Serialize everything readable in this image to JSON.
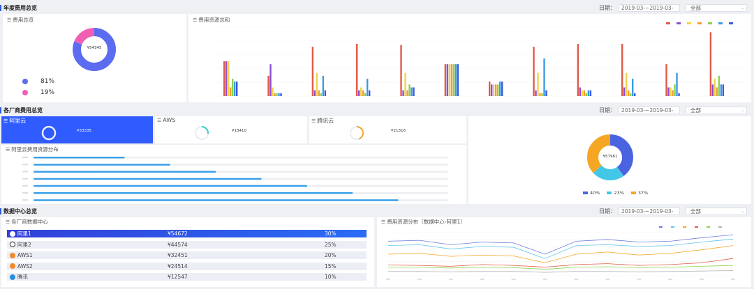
{
  "sections": {
    "annual": {
      "title": "年度费用总览",
      "date_label": "日期：",
      "date_value": "2019-03-~2019-03-",
      "select_value": "全部"
    },
    "vendor": {
      "title": "各厂商费用总览",
      "date_label": "日期：",
      "date_value": "2019-03-~2019-03-",
      "select_value": "全部"
    },
    "datacenter": {
      "title": "数据中心总览",
      "date_label": "日期：",
      "date_value": "2019-03-~2019-03-",
      "select_value": "全部"
    }
  },
  "cost_total": {
    "title": "费用总览",
    "center_value": "¥54345",
    "legend": [
      {
        "percent": "81%",
        "color": "#5b6cf0"
      },
      {
        "percent": "19%",
        "color": "#f05fb4"
      }
    ]
  },
  "resource_total": {
    "title": "费用资源总和"
  },
  "vendor_cards": [
    {
      "name": "阿里云",
      "value": "¥33335",
      "active": true
    },
    {
      "name": "AWS",
      "value": "¥13410",
      "active": false
    },
    {
      "name": "腾讯云",
      "value": "¥21316",
      "active": false
    }
  ],
  "aliyun_dist": {
    "title": "阿里云费用资源分布"
  },
  "vendor_donut": {
    "center_value": "¥57961",
    "legend": [
      {
        "percent": "40%",
        "color": "#4a63e0"
      },
      {
        "percent": "23%",
        "color": "#42c8e6"
      },
      {
        "percent": "37%",
        "color": "#f5a623"
      }
    ]
  },
  "dc_table": {
    "title": "各厂商数据中心",
    "rows": [
      {
        "name": "阿里1",
        "value": "¥54672",
        "percent": "30%",
        "icon": "aliyun-icon",
        "color": "#fff",
        "active": true
      },
      {
        "name": "阿里2",
        "value": "¥44574",
        "percent": "25%",
        "icon": "aliyun-icon",
        "color": "#333",
        "active": false
      },
      {
        "name": "AWS1",
        "value": "¥32451",
        "percent": "20%",
        "icon": "aws-icon",
        "color": "#f08a2a",
        "active": false
      },
      {
        "name": "AWS2",
        "value": "¥24514",
        "percent": "15%",
        "icon": "aws-icon",
        "color": "#f08a2a",
        "active": false
      },
      {
        "name": "腾讯",
        "value": "¥12547",
        "percent": "10%",
        "icon": "tencent-icon",
        "color": "#2a8de0",
        "active": false
      }
    ]
  },
  "dc_trend": {
    "title": "费用资源分布（数据中心-阿里1）"
  },
  "chart_data": [
    {
      "type": "bar",
      "title": "费用资源总和",
      "categories": [
        "1",
        "2",
        "3",
        "4",
        "5",
        "6",
        "7",
        "8",
        "9",
        "10",
        "11",
        "12"
      ],
      "series": [
        {
          "color": "#e05a47",
          "values": [
            60,
            35,
            85,
            90,
            88,
            55,
            25,
            85,
            90,
            90,
            55,
            110
          ]
        },
        {
          "color": "#8a4fd8",
          "values": [
            60,
            55,
            10,
            10,
            10,
            55,
            20,
            10,
            15,
            15,
            15,
            20
          ]
        },
        {
          "color": "#f2d34b",
          "values": [
            60,
            15,
            40,
            15,
            40,
            55,
            20,
            40,
            10,
            40,
            15,
            30
          ]
        },
        {
          "color": "#f59c37",
          "values": [
            15,
            5,
            10,
            10,
            10,
            55,
            20,
            5,
            10,
            10,
            10,
            15
          ]
        },
        {
          "color": "#8bd34a",
          "values": [
            30,
            5,
            5,
            5,
            20,
            55,
            20,
            5,
            5,
            5,
            20,
            35
          ]
        },
        {
          "color": "#3b9be8",
          "values": [
            25,
            5,
            35,
            30,
            15,
            55,
            25,
            65,
            10,
            30,
            40,
            20
          ]
        },
        {
          "color": "#3b5bdb",
          "values": [
            25,
            5,
            10,
            10,
            15,
            55,
            25,
            10,
            10,
            5,
            5,
            20
          ]
        }
      ],
      "ylim": [
        0,
        120
      ]
    },
    {
      "type": "bar",
      "title": "阿里云费用资源分布",
      "orientation": "horizontal",
      "values": [
        22,
        33,
        44,
        55,
        66,
        77,
        88
      ],
      "xlim": [
        0,
        100
      ]
    },
    {
      "type": "pie",
      "values": [
        40,
        23,
        37
      ],
      "colors": [
        "#4a63e0",
        "#42c8e6",
        "#f5a623"
      ]
    },
    {
      "type": "line",
      "title": "费用资源分布（数据中心-阿里1）",
      "x": [
        "1",
        "2",
        "3",
        "4",
        "5",
        "6",
        "7",
        "8",
        "9",
        "10",
        "11",
        "12"
      ],
      "series": [
        {
          "color": "#6c7cd8",
          "values": [
            80,
            82,
            72,
            78,
            76,
            50,
            80,
            84,
            78,
            80,
            88,
            95
          ]
        },
        {
          "color": "#5fc6e8",
          "values": [
            70,
            72,
            62,
            68,
            66,
            40,
            70,
            72,
            68,
            70,
            78,
            85
          ]
        },
        {
          "color": "#f5a623",
          "values": [
            50,
            52,
            45,
            48,
            46,
            30,
            50,
            55,
            48,
            52,
            60,
            70
          ]
        },
        {
          "color": "#e05a47",
          "values": [
            25,
            24,
            22,
            26,
            24,
            20,
            26,
            28,
            24,
            26,
            30,
            40
          ]
        },
        {
          "color": "#8bd34a",
          "values": [
            20,
            20,
            18,
            20,
            19,
            15,
            20,
            21,
            19,
            20,
            22,
            24
          ]
        },
        {
          "color": "#b3b3b3",
          "values": [
            10,
            10,
            9,
            10,
            10,
            8,
            10,
            10,
            9,
            10,
            11,
            12
          ]
        }
      ],
      "ylim": [
        0,
        100
      ]
    }
  ]
}
